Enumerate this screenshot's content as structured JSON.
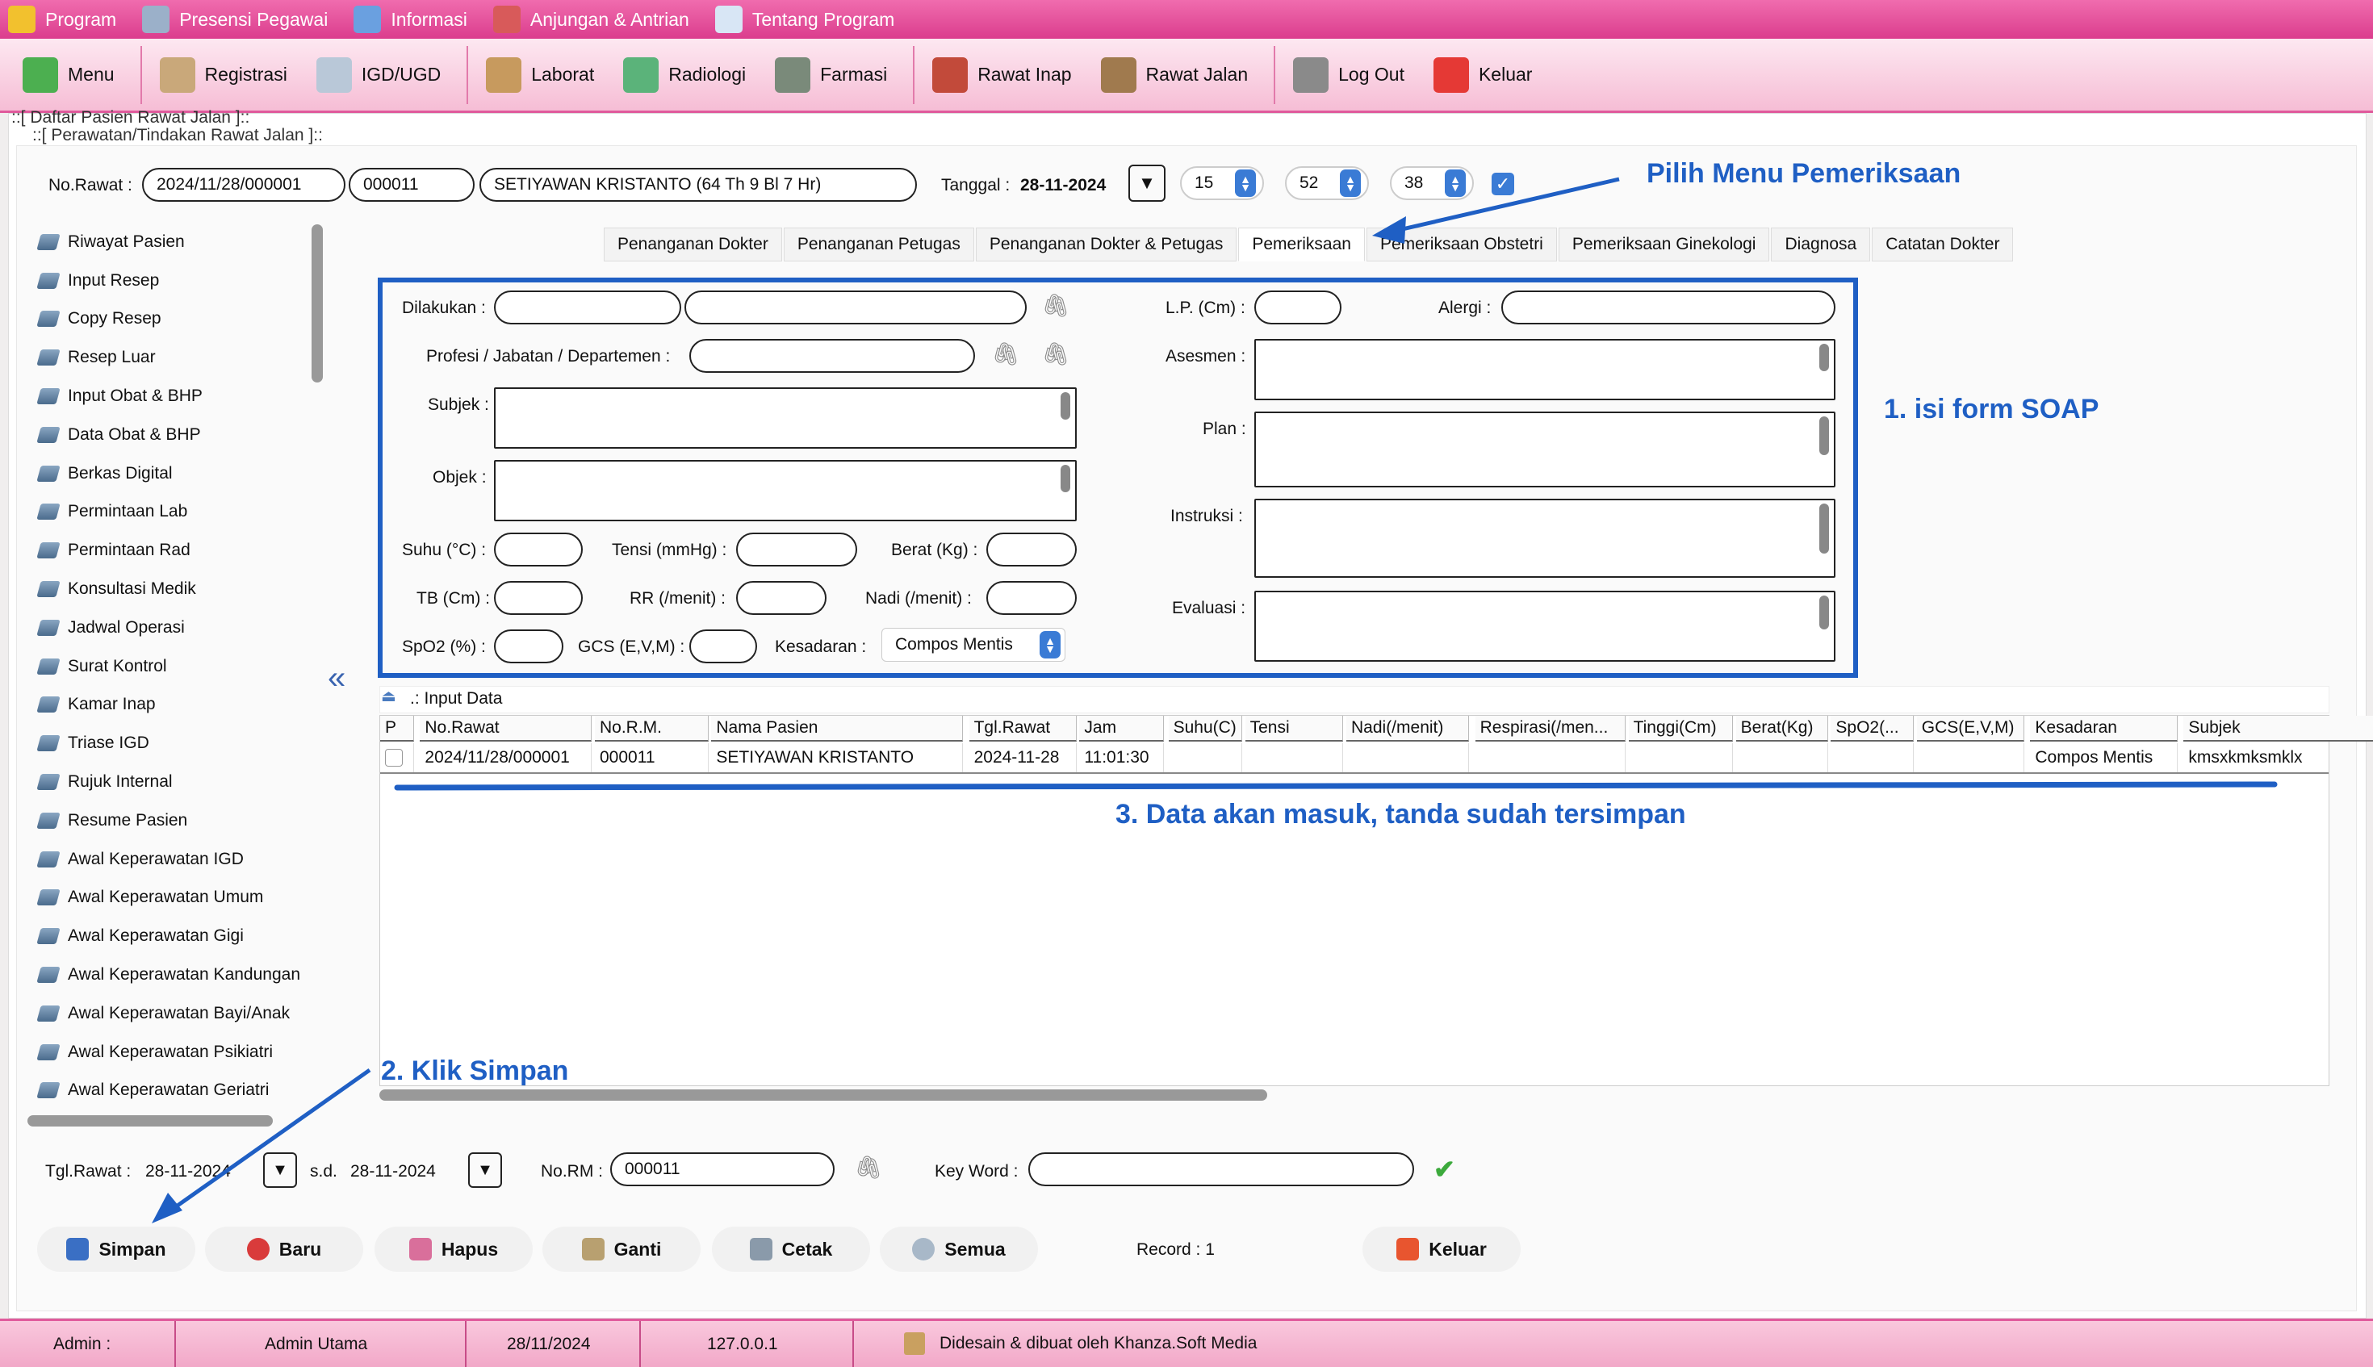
{
  "menubar": {
    "items": [
      {
        "label": "Program",
        "icon": "key-icon",
        "color": "#f2c12e"
      },
      {
        "label": "Presensi Pegawai",
        "icon": "person-icon",
        "color": "#9bb0c9"
      },
      {
        "label": "Informasi",
        "icon": "book-icon",
        "color": "#6aa0e0"
      },
      {
        "label": "Anjungan & Antrian",
        "icon": "queue-icon",
        "color": "#d85a5a"
      },
      {
        "label": "Tentang Program",
        "icon": "note-icon",
        "color": "#d8e6f5"
      }
    ]
  },
  "toolbar": {
    "items": [
      {
        "label": "Menu",
        "icon": "home-icon",
        "color": "#4caf50"
      },
      {
        "label": "Registrasi",
        "icon": "register-icon",
        "color": "#c9a87a"
      },
      {
        "label": "IGD/UGD",
        "icon": "doctor-icon",
        "color": "#b9c8d8"
      },
      {
        "label": "Laborat",
        "icon": "lab-icon",
        "color": "#c79a5e"
      },
      {
        "label": "Radiologi",
        "icon": "radiology-icon",
        "color": "#5bb37a"
      },
      {
        "label": "Farmasi",
        "icon": "pharmacy-icon",
        "color": "#7a8a7a"
      },
      {
        "label": "Rawat Inap",
        "icon": "hospital-icon",
        "color": "#c24a3a"
      },
      {
        "label": "Rawat Jalan",
        "icon": "outpatient-icon",
        "color": "#a07a4e"
      },
      {
        "label": "Log Out",
        "icon": "logout-icon",
        "color": "#8a8a8a"
      },
      {
        "label": "Keluar",
        "icon": "exit-icon",
        "color": "#e53935"
      }
    ]
  },
  "titles": {
    "outer": "::[ Daftar Pasien Rawat Jalan ]::",
    "inner": "::[ Perawatan/Tindakan Rawat Jalan ]::"
  },
  "header": {
    "no_rawat_label": "No.Rawat :",
    "no_rawat": "2024/11/28/000001",
    "no_rm": "000011",
    "patient": "SETIYAWAN KRISTANTO (64 Th 9 Bl 7 Hr)",
    "tanggal_label": "Tanggal :",
    "tanggal": "28-11-2024",
    "hour": "15",
    "minute": "52",
    "second": "38"
  },
  "sidebar": {
    "items": [
      "Riwayat Pasien",
      "Input Resep",
      "Copy Resep",
      "Resep Luar",
      "Input Obat & BHP",
      "Data Obat & BHP",
      "Berkas Digital",
      "Permintaan Lab",
      "Permintaan Rad",
      "Konsultasi Medik",
      "Jadwal Operasi",
      "Surat Kontrol",
      "Kamar Inap",
      "Triase IGD",
      "Rujuk Internal",
      "Resume Pasien",
      "Awal Keperawatan IGD",
      "Awal Keperawatan Umum",
      "Awal Keperawatan Gigi",
      "Awal Keperawatan Kandungan",
      "Awal Keperawatan Bayi/Anak",
      "Awal Keperawatan Psikiatri",
      "Awal Keperawatan Geriatri"
    ],
    "collapse": "«"
  },
  "tabs": [
    "Penanganan Dokter",
    "Penanganan Petugas",
    "Penanganan Dokter & Petugas",
    "Pemeriksaan",
    "Pemeriksaan Obstetri",
    "Pemeriksaan Ginekologi",
    "Diagnosa",
    "Catatan Dokter"
  ],
  "form": {
    "dilakukan": "Dilakukan :",
    "profesi": "Profesi / Jabatan / Departemen :",
    "subjek": "Subjek :",
    "objek": "Objek :",
    "suhu": "Suhu (°C) :",
    "tensi": "Tensi (mmHg) :",
    "berat": "Berat (Kg) :",
    "tb": "TB (Cm) :",
    "rr": "RR (/menit) :",
    "nadi": "Nadi (/menit) :",
    "spo2": "SpO2 (%) :",
    "gcs": "GCS (E,V,M) :",
    "kesadaran": "Kesadaran :",
    "kesadaran_value": "Compos Mentis",
    "lp": "L.P. (Cm) :",
    "alergi": "Alergi :",
    "asesmen": "Asesmen :",
    "plan": "Plan :",
    "instruksi": "Instruksi :",
    "evaluasi": "Evaluasi :"
  },
  "input_data_label": ".: Input Data",
  "table": {
    "headers": [
      "P",
      "No.Rawat",
      "No.R.M.",
      "Nama Pasien",
      "Tgl.Rawat",
      "Jam",
      "Suhu(C)",
      "Tensi",
      "Nadi(/menit)",
      "Respirasi(/men...",
      "Tinggi(Cm)",
      "Berat(Kg)",
      "SpO2(...",
      "GCS(E,V,M)",
      "Kesadaran",
      "Subjek"
    ],
    "rows": [
      [
        "",
        "2024/11/28/000001",
        "000011",
        "SETIYAWAN KRISTANTO",
        "2024-11-28",
        "11:01:30",
        "",
        "",
        "",
        "",
        "",
        "",
        "",
        "",
        "Compos Mentis",
        "kmsxkmksmklx"
      ]
    ]
  },
  "filter": {
    "tgl_label": "Tgl.Rawat :",
    "tgl_from": "28-11-2024",
    "sd_label": "s.d.",
    "tgl_to": "28-11-2024",
    "norm_label": "No.RM :",
    "norm": "000011",
    "keyword_label": "Key Word :",
    "keyword": ""
  },
  "buttons": {
    "simpan": "Simpan",
    "baru": "Baru",
    "hapus": "Hapus",
    "ganti": "Ganti",
    "cetak": "Cetak",
    "semua": "Semua",
    "keluar": "Keluar",
    "record": "Record :  1"
  },
  "status": {
    "user": "Admin :",
    "role": "Admin Utama",
    "date": "28/11/2024",
    "ip": "127.0.0.1",
    "credit": "Didesain & dibuat oleh Khanza.Soft Media"
  },
  "annotations": {
    "pilih": "Pilih Menu Pemeriksaan",
    "step1": "1. isi form SOAP",
    "step2": "2. Klik Simpan",
    "step3": "3. Data akan masuk, tanda sudah tersimpan"
  },
  "colors": {
    "accent": "#1f5fc4",
    "menubar": "#db3d8d"
  }
}
